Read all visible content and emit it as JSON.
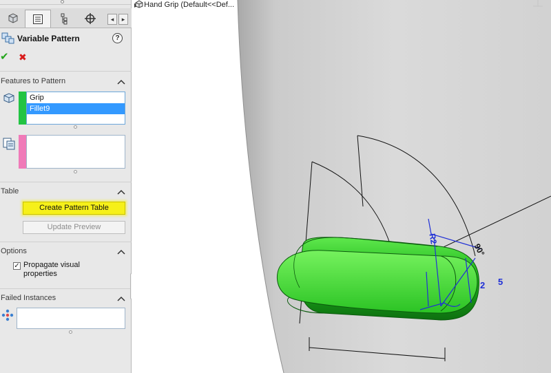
{
  "feature_manager": {
    "title": "Variable Pattern",
    "tabs": [
      {
        "name": "feature-manager",
        "icon": "feature-tree-icon"
      },
      {
        "name": "property-manager",
        "icon": "property-manager-icon"
      },
      {
        "name": "configuration-manager",
        "icon": "configuration-icon"
      },
      {
        "name": "dim-xpert-manager",
        "icon": "dimxpert-crosshair-icon"
      }
    ],
    "ok_symbol": "✔",
    "cancel_symbol": "✖",
    "help_symbol": "?"
  },
  "sections": {
    "features_to_pattern": {
      "title": "Features to Pattern",
      "items": [
        "Grip",
        "Fillet9"
      ],
      "selected_index": 1,
      "bar_color": "#22c443"
    },
    "pattern_reference": {
      "items": [],
      "bar_color": "#f07ab8"
    },
    "table": {
      "title": "Table",
      "create_label": "Create Pattern Table",
      "update_label": "Update Preview"
    },
    "options": {
      "title": "Options",
      "propagate_label": "Propagate visual properties",
      "propagate_checked": true
    },
    "failed_instances": {
      "title": "Failed Instances",
      "items": []
    }
  },
  "viewport": {
    "tree_title": "Hand Grip  (Default<<Def...",
    "dims": {
      "angle": "90°",
      "radius": "R2",
      "d2": "2",
      "d5": "5"
    },
    "colors": {
      "model": "#22b021",
      "dimension": "#1f2fd6",
      "surface": "#d6d6d6"
    }
  }
}
